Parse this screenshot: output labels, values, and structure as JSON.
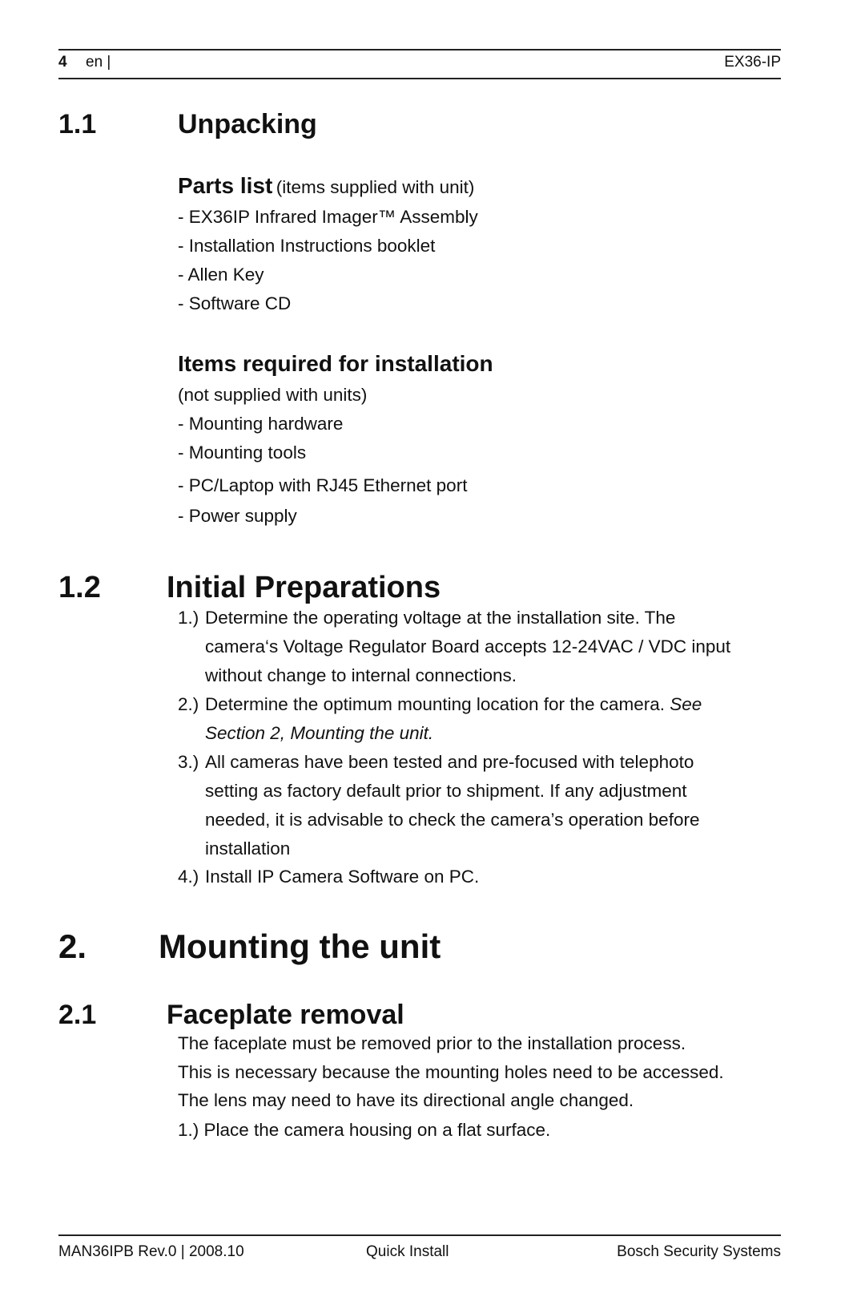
{
  "header": {
    "page_number": "4",
    "language": "en |",
    "product": "EX36-IP"
  },
  "section_1_1": {
    "number": "1.1",
    "title": "Unpacking",
    "parts_list": {
      "heading": "Parts list",
      "note": "(items supplied with unit)",
      "items": [
        "- EX36IP Infrared Imager™ Assembly",
        "- Installation Instructions booklet",
        "- Allen Key",
        "- Software CD"
      ]
    },
    "items_required": {
      "heading": "Items required for installation",
      "note": "(not supplied with units)",
      "items": [
        "- Mounting hardware",
        "- Mounting tools",
        "- PC/Laptop with RJ45 Ethernet port",
        "- Power supply"
      ]
    }
  },
  "section_1_2": {
    "number": "1.2",
    "title": "Initial Preparations",
    "steps": [
      {
        "label": "1.)",
        "lines": [
          "Determine the operating voltage at the installation site. The",
          "camera‘s Voltage Regulator Board accepts 12-24VAC / VDC input",
          "without change to internal connections."
        ]
      },
      {
        "label": "2.)",
        "lines": [
          "Determine the optimum mounting location for the camera. "
        ],
        "italic_tail": "See",
        "italic_lines": [
          "Section 2, Mounting the unit."
        ]
      },
      {
        "label": "3.)",
        "lines": [
          "All cameras have been tested and pre-focused with telephoto",
          "setting as factory default prior to shipment. If any adjustment",
          "needed, it is advisable to check the camera’s operation before",
          "installation"
        ]
      },
      {
        "label": "4.)",
        "lines": [
          "Install IP Camera Software on PC."
        ]
      }
    ]
  },
  "section_2": {
    "number": "2.",
    "title": "Mounting the unit"
  },
  "section_2_1": {
    "number": "2.1",
    "title": "Faceplate removal",
    "paragraphs": [
      "The faceplate must be removed prior to the installation process.",
      "This is necessary because the mounting holes need to be accessed.",
      "The lens may need to have its directional angle changed.",
      "1.) Place the camera housing on a flat surface."
    ]
  },
  "footer": {
    "doc_id": "MAN36IPB Rev.0 | 2008.10",
    "doc_type": "Quick Install",
    "company": "Bosch Security Systems"
  }
}
